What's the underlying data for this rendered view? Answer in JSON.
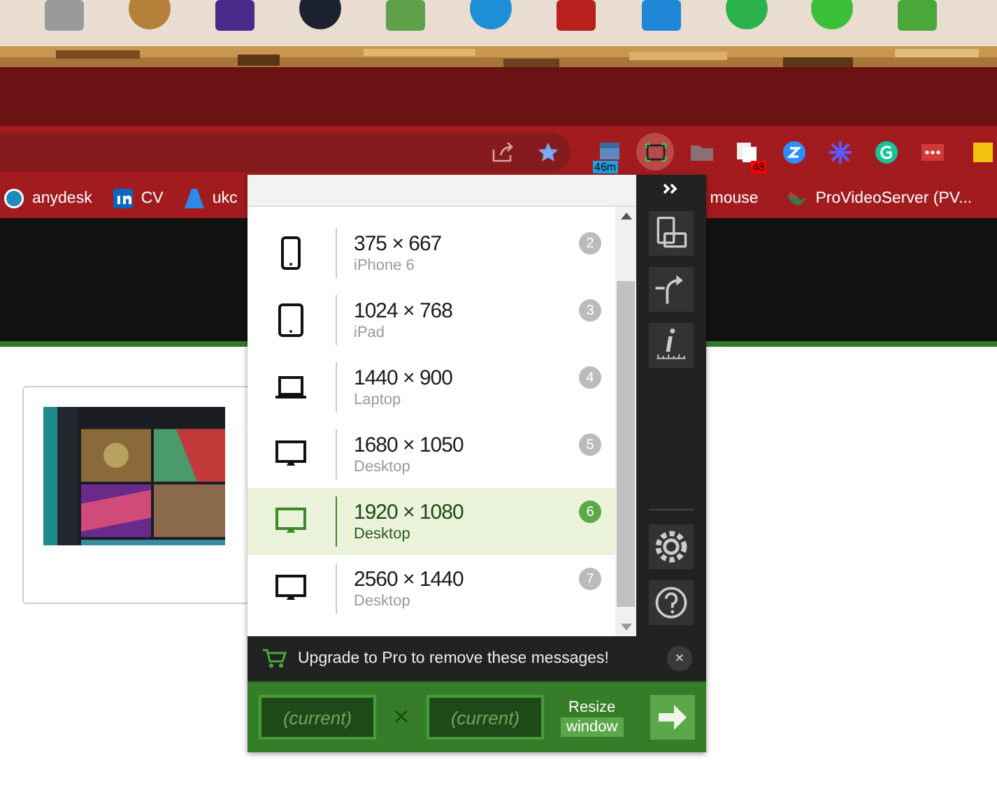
{
  "taskbar": {
    "apps": [
      {
        "kind": "square",
        "color": "#9a9a9a"
      },
      {
        "kind": "circle",
        "color": "#b5803a"
      },
      {
        "kind": "square",
        "color": "#4b2a8a"
      },
      {
        "kind": "circle",
        "color": "#1b2230"
      },
      {
        "kind": "square",
        "color": "#5fa04a"
      },
      {
        "kind": "circle",
        "color": "#1e8fd6"
      },
      {
        "kind": "square",
        "color": "#b8201e"
      },
      {
        "kind": "square",
        "color": "#1f86d6"
      },
      {
        "kind": "circle",
        "color": "#2bb24a"
      },
      {
        "kind": "circle",
        "color": "#3bbf3b"
      },
      {
        "kind": "square",
        "color": "#4aa83a"
      }
    ]
  },
  "toolbar": {
    "extensions": [
      {
        "kind": "calendar",
        "badge": "46m",
        "selected": false
      },
      {
        "kind": "resize",
        "selected": true
      },
      {
        "kind": "folder",
        "selected": false
      },
      {
        "kind": "files",
        "badge": "48",
        "selected": false
      },
      {
        "kind": "zoom",
        "selected": false
      },
      {
        "kind": "burst",
        "selected": false
      },
      {
        "kind": "grammar",
        "selected": false
      },
      {
        "kind": "dots",
        "selected": false
      },
      {
        "kind": "cut",
        "selected": false
      }
    ]
  },
  "bookmarks": [
    {
      "kind": "wordpress",
      "label": "anydesk"
    },
    {
      "kind": "linkedin",
      "label": "CV"
    },
    {
      "kind": "azure",
      "label": "ukc"
    },
    {
      "kind": "none",
      "label": "mouse"
    },
    {
      "kind": "bird",
      "label": "ProVideoServer (PV..."
    }
  ],
  "popup": {
    "devices": [
      {
        "kind": "phone",
        "size": "375 × 667",
        "name": "iPhone 6",
        "number": "2",
        "selected": false
      },
      {
        "kind": "tablet",
        "size": "1024 × 768",
        "name": "iPad",
        "number": "3",
        "selected": false
      },
      {
        "kind": "laptop",
        "size": "1440 × 900",
        "name": "Laptop",
        "number": "4",
        "selected": false
      },
      {
        "kind": "desktop",
        "size": "1680 × 1050",
        "name": "Desktop",
        "number": "5",
        "selected": false
      },
      {
        "kind": "desktop",
        "size": "1920 × 1080",
        "name": "Desktop",
        "number": "6",
        "selected": true
      },
      {
        "kind": "desktop",
        "size": "2560 × 1440",
        "name": "Desktop",
        "number": "7",
        "selected": false
      }
    ],
    "message": "Upgrade to Pro to remove these messages!",
    "close": "×",
    "width_placeholder": "(current)",
    "times": "×",
    "height_placeholder": "(current)",
    "resize_label": "Resize",
    "resize_sublabel": "window"
  }
}
